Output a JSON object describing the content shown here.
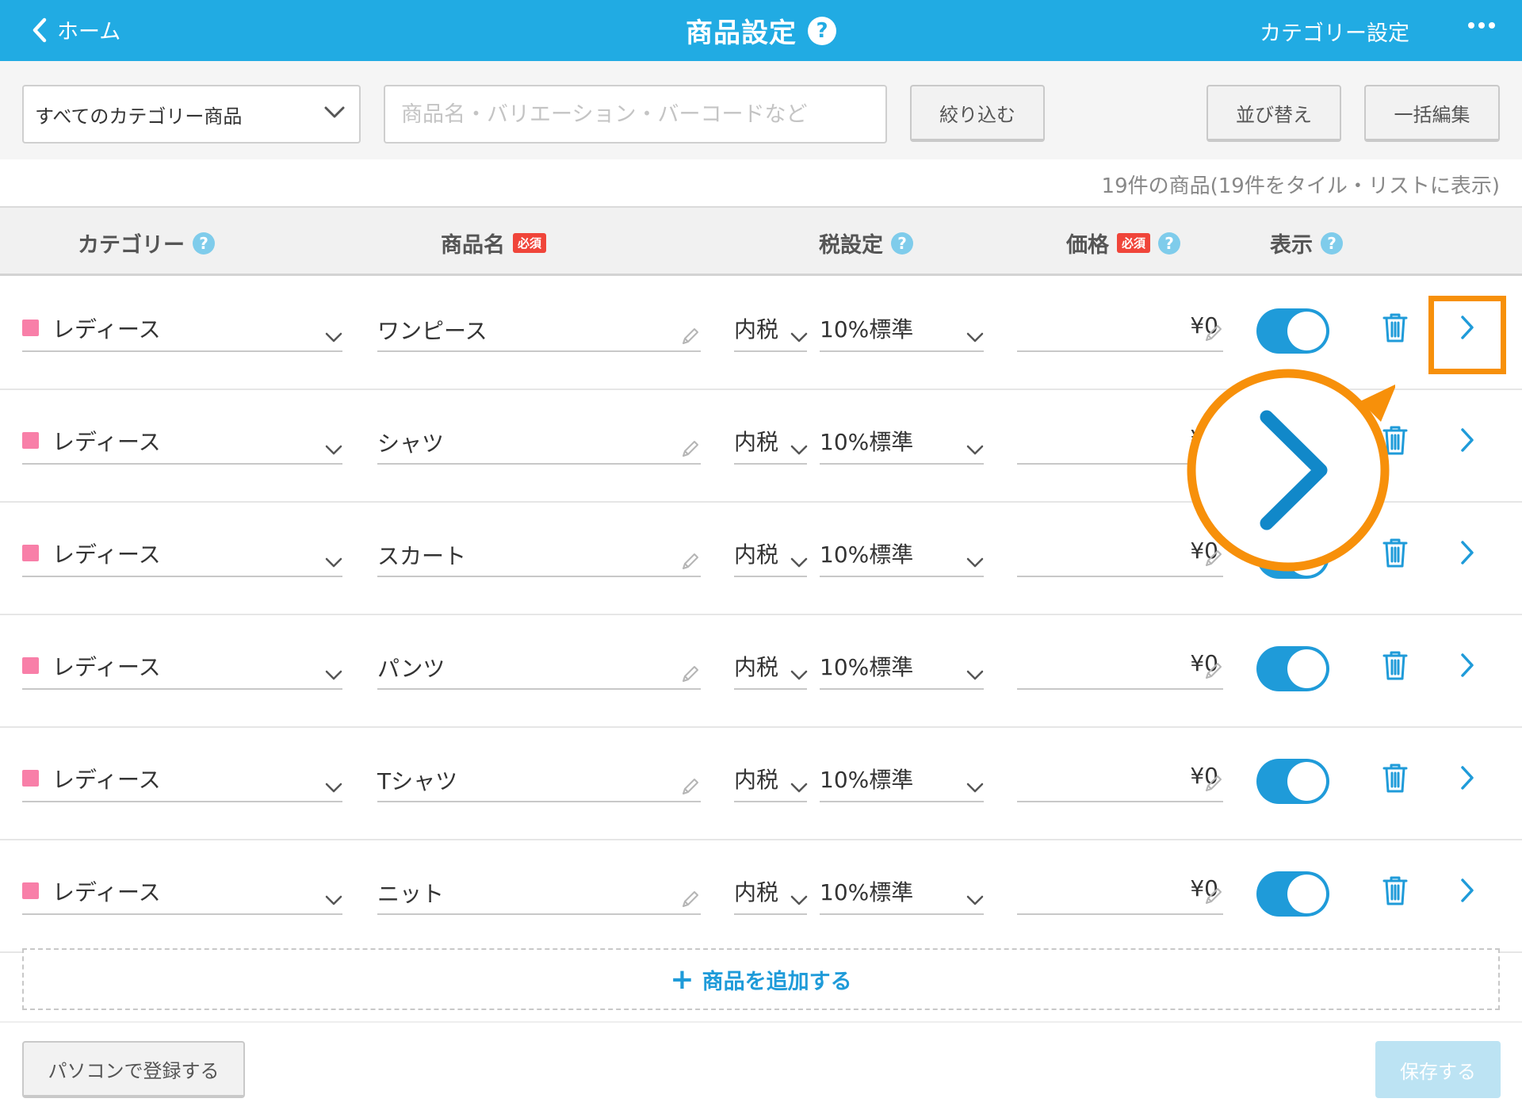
{
  "header": {
    "back_label": "ホーム",
    "title": "商品設定",
    "help": "?",
    "category_setting": "カテゴリー設定"
  },
  "filter": {
    "category_select": "すべてのカテゴリー商品",
    "search_placeholder": "商品名・バリエーション・バーコードなど",
    "filter_button": "絞り込む",
    "sort_button": "並び替え",
    "bulk_edit_button": "一括編集"
  },
  "count_text": "19件の商品(19件をタイル・リストに表示)",
  "columns": {
    "category": "カテゴリー",
    "name": "商品名",
    "tax": "税設定",
    "price": "価格",
    "display": "表示",
    "required": "必須",
    "help": "?"
  },
  "rows": [
    {
      "category": "レディース",
      "name": "ワンピース",
      "tax_type": "内税",
      "tax_rate": "10%標準",
      "price": "¥0",
      "visible": true
    },
    {
      "category": "レディース",
      "name": "シャツ",
      "tax_type": "内税",
      "tax_rate": "10%標準",
      "price": "¥0",
      "visible": true
    },
    {
      "category": "レディース",
      "name": "スカート",
      "tax_type": "内税",
      "tax_rate": "10%標準",
      "price": "¥0",
      "visible": true
    },
    {
      "category": "レディース",
      "name": "パンツ",
      "tax_type": "内税",
      "tax_rate": "10%標準",
      "price": "¥0",
      "visible": true
    },
    {
      "category": "レディース",
      "name": "Tシャツ",
      "tax_type": "内税",
      "tax_rate": "10%標準",
      "price": "¥0",
      "visible": true
    },
    {
      "category": "レディース",
      "name": "ニット",
      "tax_type": "内税",
      "tax_rate": "10%標準",
      "price": "¥0",
      "visible": true
    }
  ],
  "add_product": "商品を追加する",
  "footer": {
    "register_pc": "パソコンで登録する",
    "save": "保存する"
  },
  "colors": {
    "brand": "#21ABE3",
    "accent": "#1F9BD9",
    "category_marker": "#F87FA8",
    "required_badge": "#F0453A",
    "annotation": "#F7900A"
  },
  "icons": [
    "chevron-left-icon",
    "help-icon",
    "more-icon",
    "chevron-down-icon",
    "pencil-icon",
    "trash-icon",
    "chevron-right-icon"
  ]
}
